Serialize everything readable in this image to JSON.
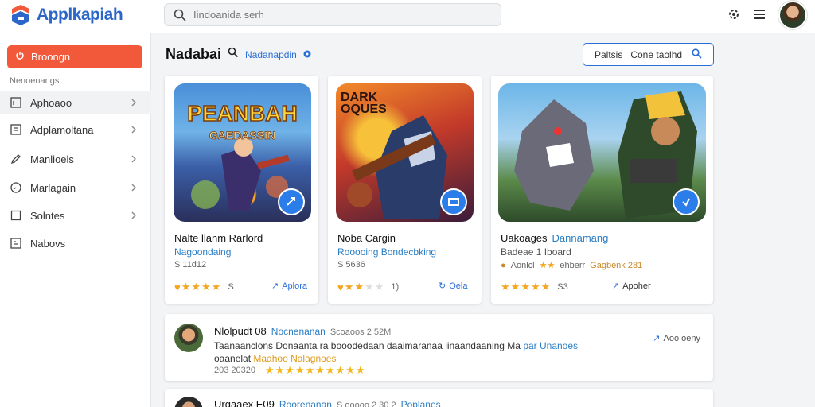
{
  "app": {
    "name": "Applkapiah",
    "brand_color": "#2b66c8",
    "accent_color": "#f2593b"
  },
  "search": {
    "placeholder": "Iindoanida serh",
    "value": ""
  },
  "header": {
    "icons": [
      "settings-icon",
      "menu-icon"
    ]
  },
  "sidebar": {
    "primary_button": "Broongn",
    "section_label": "Nenoenangs",
    "items": [
      {
        "label": "Aphoaoo",
        "icon": "window-icon"
      },
      {
        "label": "Adplamoltana",
        "icon": "chart-icon"
      },
      {
        "label": "Manlioels",
        "icon": "pencil-icon"
      },
      {
        "label": "Marlagain",
        "icon": "dashboard-icon"
      },
      {
        "label": "Solntes",
        "icon": "box-icon"
      },
      {
        "label": "Nabovs",
        "icon": "list-icon"
      }
    ]
  },
  "main": {
    "title": "Nadabai",
    "title_link": "Nadanapdin",
    "create_button": "Paltsis   Cone taolhd"
  },
  "cards": [
    {
      "thumb_title": "PEANBAH",
      "thumb_subtitle": "GAEDASSIN",
      "title": "Nalte llanm Rarlord",
      "subtitle": "Nagoondaing",
      "meta": "S 11d12",
      "rating": 5,
      "rating_count": "S",
      "action": "Aplora"
    },
    {
      "thumb_title": "DARK OQUES",
      "thumb_subtitle": "",
      "title": "Noba Cargin",
      "subtitle": "Rooooing Bondecbking",
      "meta": "S 5636",
      "rating": 3,
      "rating_count": "1)",
      "action": "Oela"
    },
    {
      "thumb_title": "",
      "thumb_subtitle": "",
      "title": "Uakoages",
      "subtitle": "Dannamang",
      "meta_prefix": "Badeae 1 Iboard",
      "meta_line2_a": "Aonlcl",
      "meta_line2_b": "ehberr",
      "meta_line2_c": "Gagbenk 281",
      "rating": 5,
      "rating_count": "S3",
      "action": "Apoher"
    }
  ],
  "reviews": [
    {
      "name": "Nlolpudt 08",
      "role": "Nocnenanan",
      "date": "Scoaoos 2 52M",
      "body_a": "Taanaanclons Donaanta ra booodedaan daaimaranaa  linaandaaning Ma",
      "body_b": "par Unanoes",
      "body2_a": "oaanelat",
      "body2_b": "Maahoo Nalagnoes",
      "meta_date": "203 20320",
      "rating": 10,
      "action": "Aoo oeny"
    },
    {
      "name": "Urgaaex E09",
      "role": "Roorenanan",
      "date": "S ooooo 2 30 2",
      "body_a": "Poplanes"
    }
  ]
}
